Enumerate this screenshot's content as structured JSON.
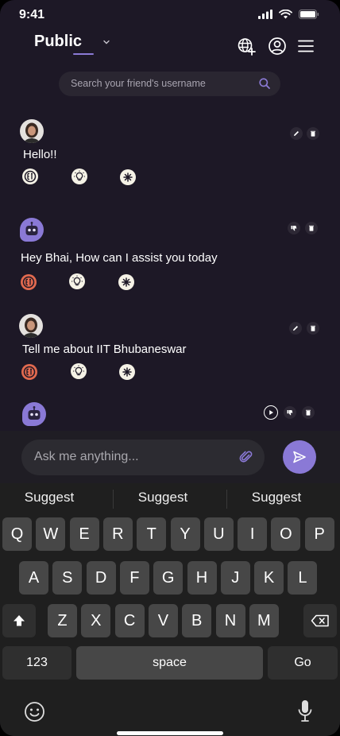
{
  "status_bar": {
    "time": "9:41"
  },
  "header": {
    "title": "Public"
  },
  "search": {
    "placeholder": "Search your friend's username"
  },
  "messages": [
    {
      "sender": "user",
      "text": "Hello!!"
    },
    {
      "sender": "bot",
      "text": "Hey Bhai, How can I assist you today"
    },
    {
      "sender": "user",
      "text": "Tell me about IIT Bhubaneswar"
    },
    {
      "sender": "bot",
      "text": ""
    }
  ],
  "colors": {
    "background": "#1d1826",
    "accent": "#8a79d6",
    "keyboard": "#1f1f1f",
    "key": "#474747"
  },
  "composer": {
    "placeholder": "Ask me anything..."
  },
  "keyboard": {
    "suggestions": [
      "Suggest",
      "Suggest",
      "Suggest"
    ],
    "row1": [
      "Q",
      "W",
      "E",
      "R",
      "T",
      "Y",
      "U",
      "I",
      "O",
      "P"
    ],
    "row2": [
      "A",
      "S",
      "D",
      "F",
      "G",
      "H",
      "J",
      "K",
      "L"
    ],
    "row3": [
      "Z",
      "X",
      "C",
      "V",
      "B",
      "N",
      "M"
    ],
    "numbers_label": "123",
    "space_label": "space",
    "go_label": "Go"
  }
}
